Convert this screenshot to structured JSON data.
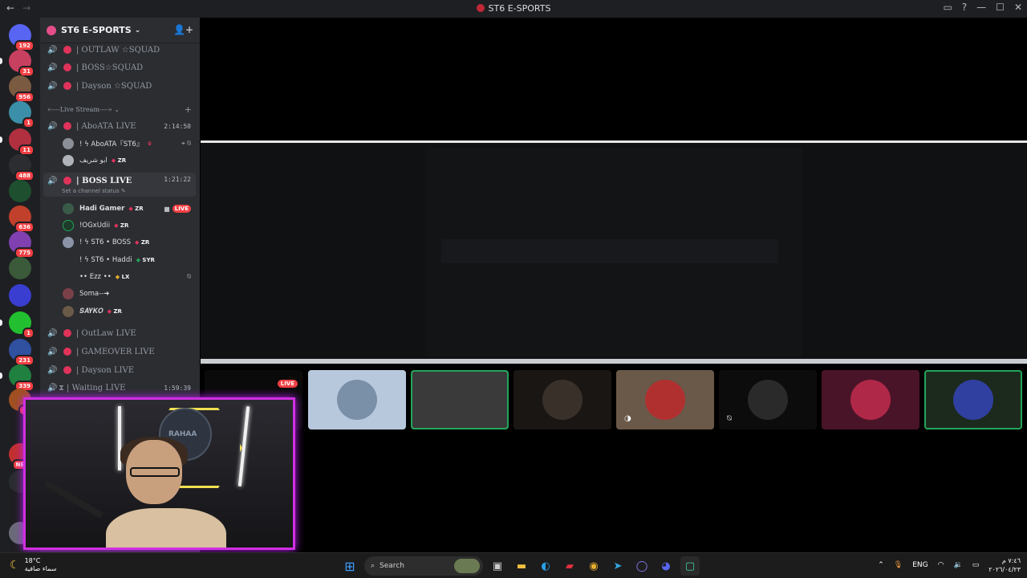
{
  "window": {
    "title": "ST6 E-SPORTS",
    "nav_back": "←",
    "nav_forward": "→",
    "controls": [
      "▭",
      "?",
      "—",
      "☐",
      "✕"
    ]
  },
  "rail": {
    "servers": [
      {
        "badge": "192",
        "color": "#5865f2"
      },
      {
        "badge": "31",
        "color": "#c84060"
      },
      {
        "badge": "956",
        "color": "#7a5a40"
      },
      {
        "badge": "1",
        "color": "#3b8fa8"
      },
      {
        "badge": "11",
        "color": "#b03040"
      },
      {
        "badge": "488",
        "color": "#2b2d31"
      },
      {
        "badge": "",
        "color": "#1e5030"
      },
      {
        "badge": "636",
        "color": "#c0402c"
      },
      {
        "badge": "775",
        "color": "#8040b0"
      },
      {
        "badge": "",
        "color": "#3a5a3a"
      },
      {
        "badge": "",
        "color": "#3a3ed0"
      },
      {
        "badge": "1",
        "color": "#22c030"
      },
      {
        "badge": "231",
        "color": "#3050a0"
      },
      {
        "badge": "339",
        "color": "#208040"
      },
      {
        "badge": "61",
        "color": "#a05020"
      },
      {
        "badge": "NEW",
        "color": "#c03030"
      },
      {
        "badge": "",
        "color": "#2b2d31"
      },
      {
        "badge": "",
        "color": "#6a6a7a"
      }
    ]
  },
  "sidebar": {
    "guild_name": "ST6 E-SPORTS",
    "channels_top": [
      {
        "name": "| OUTLAW ☆SQUAD"
      },
      {
        "name": "| BOSS☆SQUAD"
      },
      {
        "name": "| Dayson ☆SQUAD"
      }
    ],
    "category": "«----Live Stream----» ⌄",
    "abo_channel": {
      "name": "| AboATA LIVE",
      "time": "2:14:50"
    },
    "abo_users": [
      {
        "name": "! ϟ AboATA『ST6』",
        "tag": "♛",
        "icons": "⌖ ⍉"
      },
      {
        "name": "ابو شريف",
        "tag": "ZR"
      }
    ],
    "boss_channel": {
      "name": "| BOSS LIVE",
      "time": "1:21:22",
      "status": "Set a channel status ✎"
    },
    "boss_users": [
      {
        "name": "Hadi Gamer",
        "tag": "ZR",
        "live": "LIVE"
      },
      {
        "name": "!OGxUdii",
        "tag": "ZR"
      },
      {
        "name": "! ϟ ST6 • BOSS",
        "tag": "ZR"
      },
      {
        "name": "! ϟ ST6 • Haddi",
        "tag": "SYR"
      },
      {
        "name": "•• Ezz ••",
        "tag": "LX"
      },
      {
        "name": "Soma--➜",
        "tag": ""
      },
      {
        "name": "𝑺𝑨𝒀𝑲𝑶",
        "tag": "ZR"
      }
    ],
    "channels_bottom": [
      {
        "name": "| OutLaw LIVE",
        "time": ""
      },
      {
        "name": "| GAMEOVER LIVE",
        "time": ""
      },
      {
        "name": "| Dayson LIVE",
        "time": ""
      },
      {
        "name": "| Waiting LIVE",
        "time": "1:59:39"
      }
    ]
  },
  "stage": {
    "live_label": "LIVE",
    "tiles": [
      {
        "bg": "#b8c8dc",
        "circle": "#7a8fa8"
      },
      {
        "bg": "#c8ccd0",
        "circle": "#3a3a3a"
      },
      {
        "bg": "#1a1614",
        "circle": "#3a302a"
      },
      {
        "bg": "#6a5848",
        "circle": "#b03030"
      },
      {
        "bg": "#0c0c0c",
        "circle": "#2a2a2a"
      },
      {
        "bg": "#4a1428",
        "circle": "#b02848"
      },
      {
        "bg": "#1c2a1e",
        "circle": "#3040a0"
      }
    ]
  },
  "webcam": {
    "logo_text": "RAHAA"
  },
  "taskbar": {
    "temp": "18°C",
    "weather_desc": "سماء صافية",
    "search_placeholder": "Search",
    "lang": "ENG",
    "time": "٧:٤٦ م",
    "date": "٢٠٢٦/٠٤/٢٣"
  }
}
